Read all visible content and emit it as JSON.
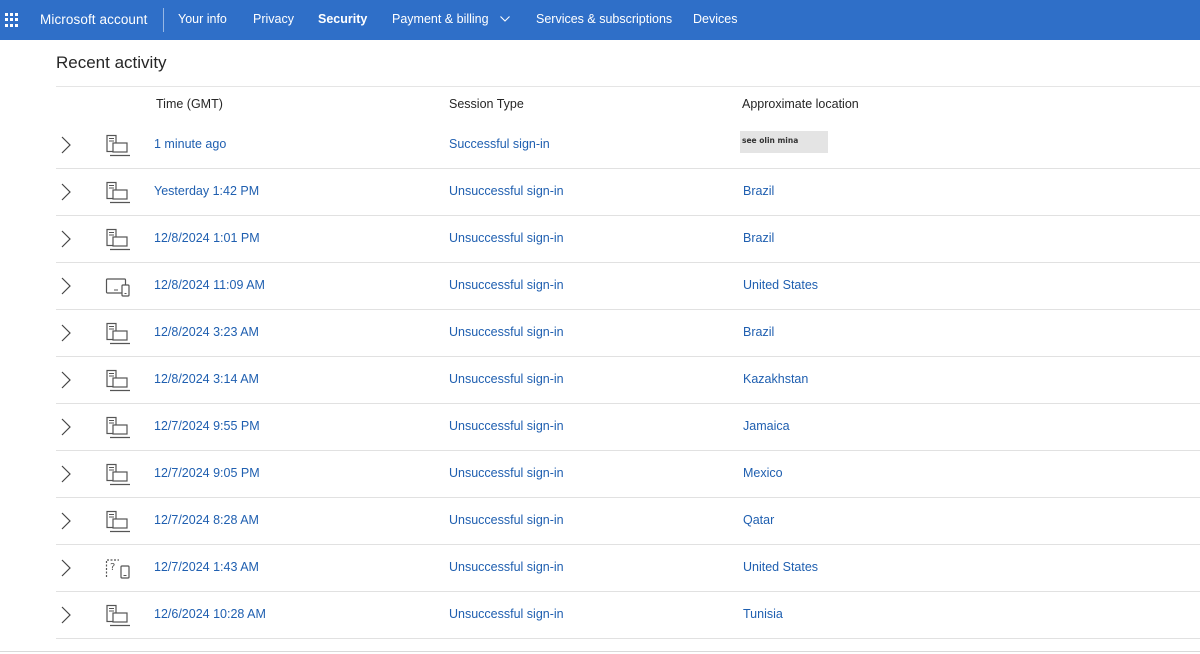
{
  "nav": {
    "brand": "Microsoft account",
    "items": [
      {
        "label": "Your info",
        "active": false
      },
      {
        "label": "Privacy",
        "active": false
      },
      {
        "label": "Security",
        "active": true
      },
      {
        "label": "Payment & billing",
        "active": false,
        "dropdown": true
      },
      {
        "label": "Services & subscriptions",
        "active": false
      },
      {
        "label": "Devices",
        "active": false
      }
    ],
    "bar_color": "#2f6fc8"
  },
  "page": {
    "title": "Recent activity"
  },
  "table": {
    "headers": {
      "time": "Time (GMT)",
      "type": "Session Type",
      "location": "Approximate location"
    },
    "rows": [
      {
        "time": "1 minute ago",
        "type": "Successful sign-in",
        "location": "see olin mina",
        "location_redacted": true,
        "device": "pc-icon"
      },
      {
        "time": "Yesterday 1:42 PM",
        "type": "Unsuccessful sign-in",
        "location": "Brazil",
        "device": "pc-icon"
      },
      {
        "time": "12/8/2024 1:01 PM",
        "type": "Unsuccessful sign-in",
        "location": "Brazil",
        "device": "pc-icon"
      },
      {
        "time": "12/8/2024 11:09 AM",
        "type": "Unsuccessful sign-in",
        "location": "United States",
        "device": "tablet-phone-icon"
      },
      {
        "time": "12/8/2024 3:23 AM",
        "type": "Unsuccessful sign-in",
        "location": "Brazil",
        "device": "pc-icon"
      },
      {
        "time": "12/8/2024 3:14 AM",
        "type": "Unsuccessful sign-in",
        "location": "Kazakhstan",
        "device": "pc-icon"
      },
      {
        "time": "12/7/2024 9:55 PM",
        "type": "Unsuccessful sign-in",
        "location": "Jamaica",
        "device": "pc-icon"
      },
      {
        "time": "12/7/2024 9:05 PM",
        "type": "Unsuccessful sign-in",
        "location": "Mexico",
        "device": "pc-icon"
      },
      {
        "time": "12/7/2024 8:28 AM",
        "type": "Unsuccessful sign-in",
        "location": "Qatar",
        "device": "pc-icon"
      },
      {
        "time": "12/7/2024 1:43 AM",
        "type": "Unsuccessful sign-in",
        "location": "United States",
        "device": "unknown-device-icon"
      },
      {
        "time": "12/6/2024 10:28 AM",
        "type": "Unsuccessful sign-in",
        "location": "Tunisia",
        "device": "pc-icon"
      }
    ],
    "link_color": "#1f5fb0"
  }
}
